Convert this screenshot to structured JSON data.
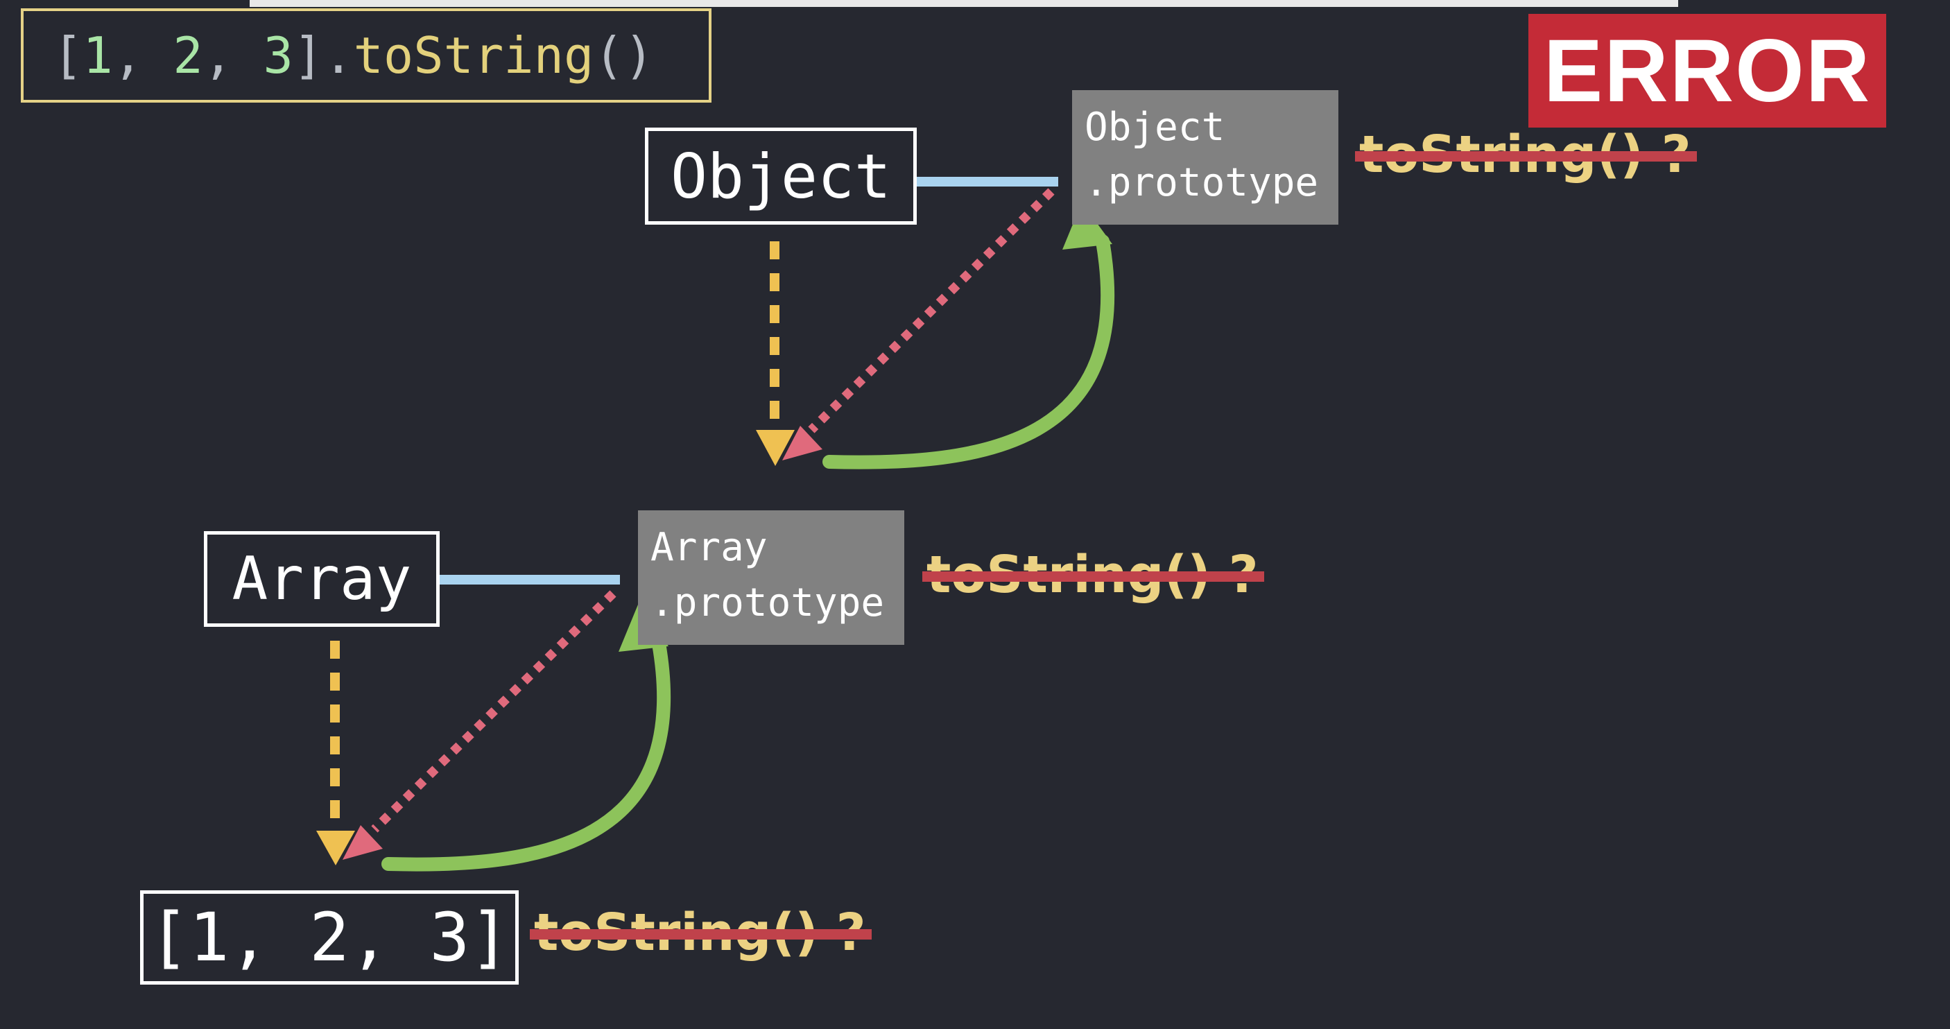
{
  "code": {
    "open_bracket": "[",
    "n1": "1",
    "comma1": ", ",
    "n2": "2",
    "comma2": ", ",
    "n3": "3",
    "close_bracket": "]",
    "dot": ".",
    "method": "toString",
    "parens": "()"
  },
  "error_label": "ERROR",
  "nodes": {
    "object_label": "Object",
    "array_label": "Array",
    "instance_label": "[1, 2, 3]"
  },
  "prototypes": {
    "object_proto": "Object\n.prototype",
    "array_proto": "Array\n.prototype"
  },
  "lookups": {
    "object_proto_lookup": "toString() ?",
    "array_proto_lookup": "toString() ?",
    "instance_lookup": "toString() ?"
  },
  "colors": {
    "background": "#262830",
    "code_border": "#e5d287",
    "proto_fill": "#818181",
    "link_line": "#a9d3ef",
    "dashed_yellow": "#efc152",
    "dotted_pink": "#e06a7c",
    "curve_green": "#8dc35b",
    "strike_red": "#c0424b",
    "strike_text": "#ecd283",
    "error_red": "#c42b37"
  }
}
